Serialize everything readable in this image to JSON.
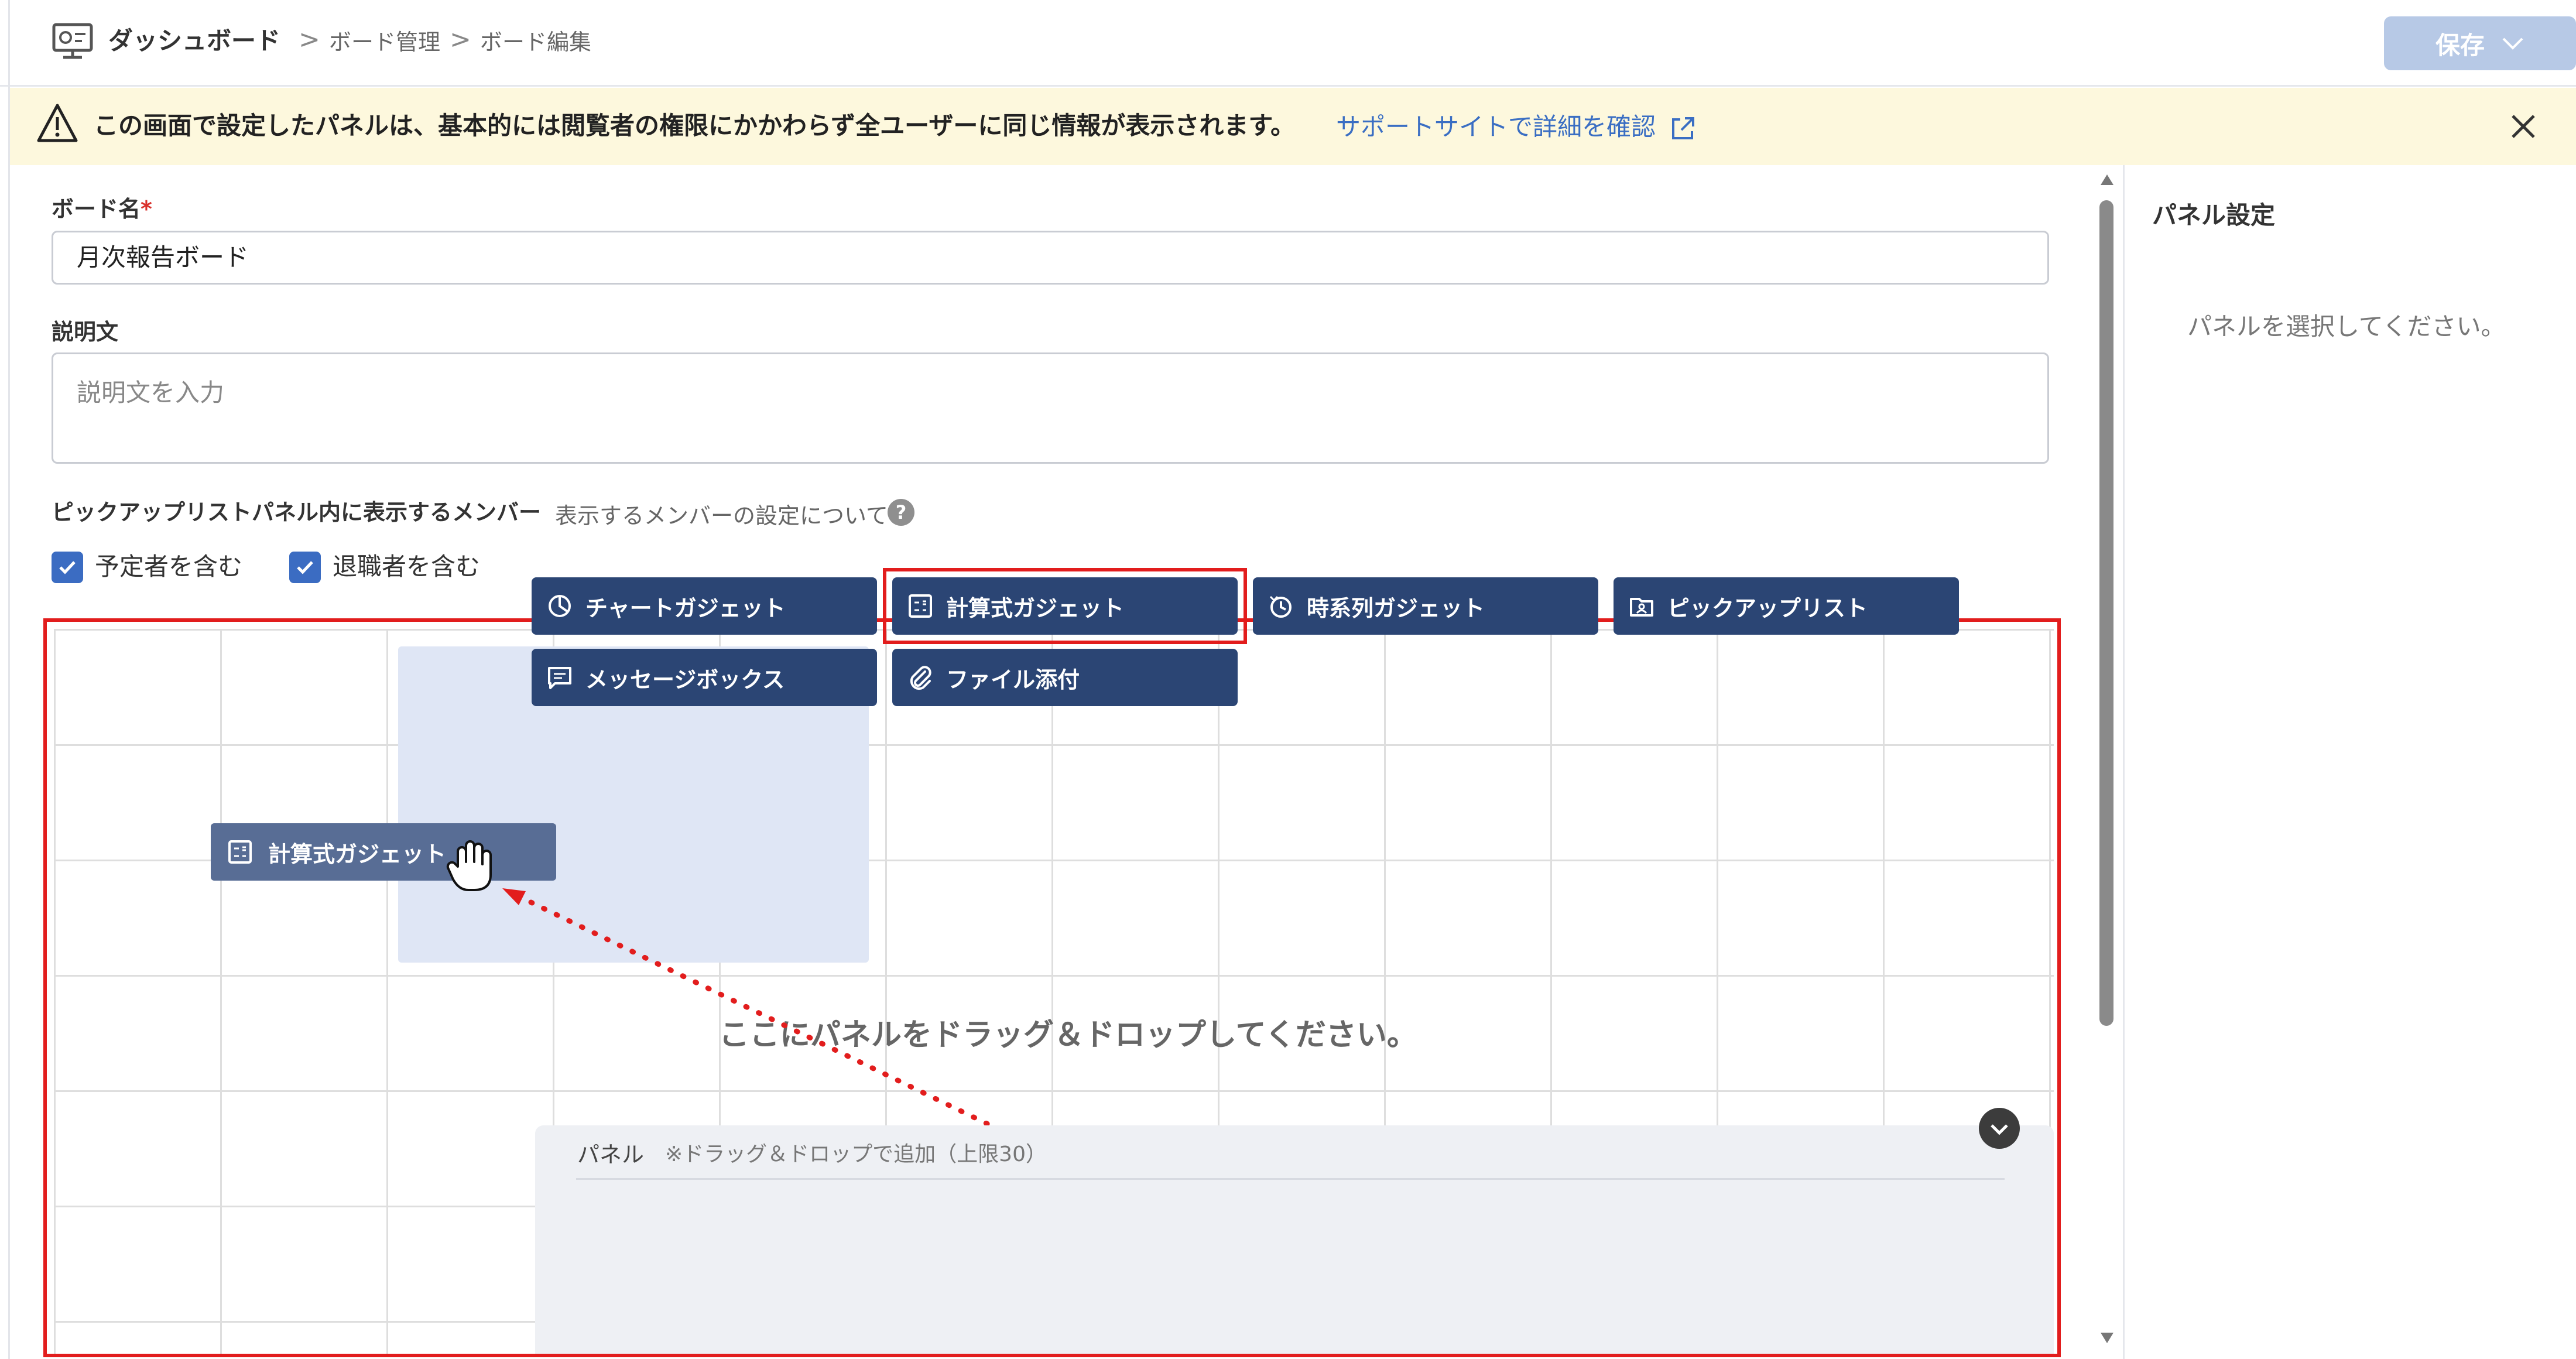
{
  "header": {
    "app_title": "ダッシュボード",
    "breadcrumb": [
      "ボード管理",
      "ボード編集"
    ],
    "breadcrumb_separator": ">",
    "save_label": "保存",
    "app_icon": "dashboard-monitor-icon"
  },
  "banner": {
    "text": "この画面で設定したパネルは、基本的には閲覧者の権限にかかわらず全ユーザーに同じ情報が表示されます。",
    "link_text": "サポートサイトで詳細を確認",
    "icon": "warning-triangle-icon",
    "background": "#fdf8dd"
  },
  "form": {
    "board_name_label": "ボード名",
    "required_mark": "*",
    "board_name_value": "月次報告ボード",
    "description_label": "説明文",
    "description_placeholder": "説明文を入力",
    "pickup_label": "ピックアップリストパネル内に表示するメンバー",
    "pickup_help_text": "表示するメンバーの設定について",
    "help_icon_glyph": "?",
    "checkboxes": [
      {
        "label": "予定者を含む",
        "checked": true
      },
      {
        "label": "退職者を含む",
        "checked": true
      }
    ]
  },
  "canvas": {
    "drop_hint": "ここにパネルをドラッグ＆ドロップしてください。",
    "dragging_item_label": "計算式ガジェット",
    "highlight_color": "#e21d1d"
  },
  "tray": {
    "title": "パネル",
    "note": "※ドラッグ＆ドロップで追加（上限30）",
    "buttons": [
      {
        "label": "チャートガジェット",
        "icon": "pie-chart-icon"
      },
      {
        "label": "計算式ガジェット",
        "icon": "calculator-icon"
      },
      {
        "label": "時系列ガジェット",
        "icon": "timeline-chart-icon"
      },
      {
        "label": "ピックアップリスト",
        "icon": "folder-person-icon"
      },
      {
        "label": "メッセージボックス",
        "icon": "message-icon"
      },
      {
        "label": "ファイル添付",
        "icon": "paperclip-icon"
      }
    ],
    "button_color": "#2b4574"
  },
  "settings": {
    "title": "パネル設定",
    "empty_text": "パネルを選択してください。"
  },
  "colors": {
    "accent": "#3b6cc2",
    "link": "#3a6ec3",
    "save_disabled": "#b7c9e6"
  }
}
